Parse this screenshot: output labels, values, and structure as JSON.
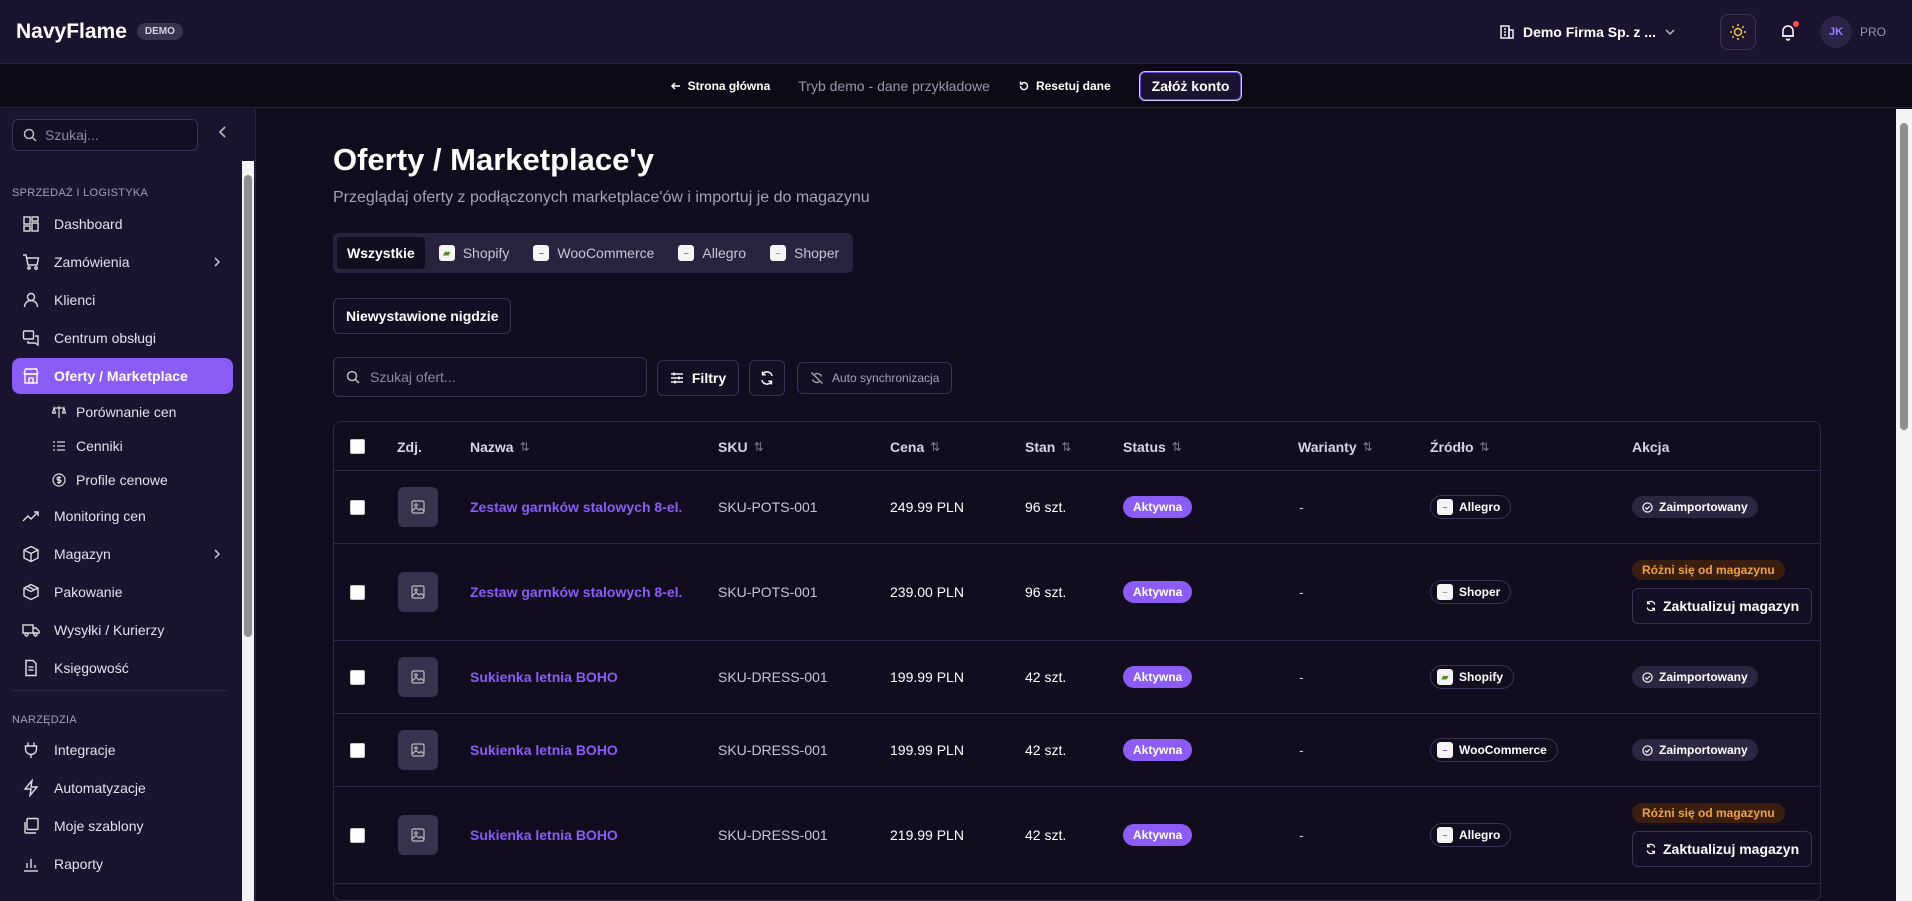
{
  "header": {
    "brand": "NavyFlame",
    "badge": "DEMO",
    "company": "Demo Firma Sp. z ...",
    "avatar_initials": "JK",
    "plan": "PRO"
  },
  "demobar": {
    "home": "Strona główna",
    "mode": "Tryb demo - dane przykładowe",
    "reset": "Resetuj dane",
    "signup": "Załóż konto"
  },
  "sidebar": {
    "search_placeholder": "Szukaj...",
    "section_sales": "SPRZEDAŻ I LOGISTYKA",
    "section_tools": "NARZĘDZIA",
    "items": [
      {
        "label": "Dashboard",
        "icon": "dashboard-icon"
      },
      {
        "label": "Zamówienia",
        "icon": "cart-icon"
      },
      {
        "label": "Klienci",
        "icon": "user-icon"
      },
      {
        "label": "Centrum obsługi",
        "icon": "chat-icon"
      },
      {
        "label": "Oferty / Marketplace",
        "icon": "store-icon"
      },
      {
        "label": "Porównanie cen",
        "icon": "scale-icon"
      },
      {
        "label": "Cenniki",
        "icon": "list-icon"
      },
      {
        "label": "Profile cenowe",
        "icon": "dollar-icon"
      },
      {
        "label": "Monitoring cen",
        "icon": "trend-icon"
      },
      {
        "label": "Magazyn",
        "icon": "box-icon"
      },
      {
        "label": "Pakowanie",
        "icon": "package-icon"
      },
      {
        "label": "Wysyłki / Kurierzy",
        "icon": "truck-icon"
      },
      {
        "label": "Księgowość",
        "icon": "document-icon"
      },
      {
        "label": "Integracje",
        "icon": "plug-icon"
      },
      {
        "label": "Automatyzacje",
        "icon": "bolt-icon"
      },
      {
        "label": "Moje szablony",
        "icon": "template-icon"
      },
      {
        "label": "Raporty",
        "icon": "chart-icon"
      }
    ]
  },
  "page": {
    "title": "Oferty / Marketplace'y",
    "subtitle": "Przeglądaj oferty z podłączonych marketplace'ów i importuj je do magazynu",
    "tabs": [
      "Wszystkie",
      "Shopify",
      "WooCommerce",
      "Allegro",
      "Shoper"
    ],
    "unlisted_button": "Niewystawione nigdzie",
    "search_placeholder": "Szukaj ofert...",
    "filters_label": "Filtry",
    "auto_sync_label": "Auto synchronizacja"
  },
  "table": {
    "columns": [
      "Zdj.",
      "Nazwa",
      "SKU",
      "Cena",
      "Stan",
      "Status",
      "Warianty",
      "Źródło",
      "Akcja"
    ],
    "rows": [
      {
        "name": "Zestaw garnków stalowych 8-el.",
        "sku": "SKU-POTS-001",
        "price": "249.99 PLN",
        "stock": "96 szt.",
        "status": "Aktywna",
        "variants": "-",
        "source": "Allegro",
        "action": "imported"
      },
      {
        "name": "Zestaw garnków stalowych 8-el.",
        "sku": "SKU-POTS-001",
        "price": "239.00 PLN",
        "stock": "96 szt.",
        "status": "Aktywna",
        "variants": "-",
        "source": "Shoper",
        "action": "diff"
      },
      {
        "name": "Sukienka letnia BOHO",
        "sku": "SKU-DRESS-001",
        "price": "199.99 PLN",
        "stock": "42 szt.",
        "status": "Aktywna",
        "variants": "-",
        "source": "Shopify",
        "action": "imported"
      },
      {
        "name": "Sukienka letnia BOHO",
        "sku": "SKU-DRESS-001",
        "price": "199.99 PLN",
        "stock": "42 szt.",
        "status": "Aktywna",
        "variants": "-",
        "source": "WooCommerce",
        "action": "imported"
      },
      {
        "name": "Sukienka letnia BOHO",
        "sku": "SKU-DRESS-001",
        "price": "219.99 PLN",
        "stock": "42 szt.",
        "status": "Aktywna",
        "variants": "-",
        "source": "Allegro",
        "action": "diff"
      }
    ],
    "imported_label": "Zaimportowany",
    "diff_label": "Różni się od magazynu",
    "update_label": "Zaktualizuj magazyn"
  },
  "colors": {
    "accent": "#8b5cf6",
    "background": "#110c1e",
    "warning": "#f2a03d"
  }
}
